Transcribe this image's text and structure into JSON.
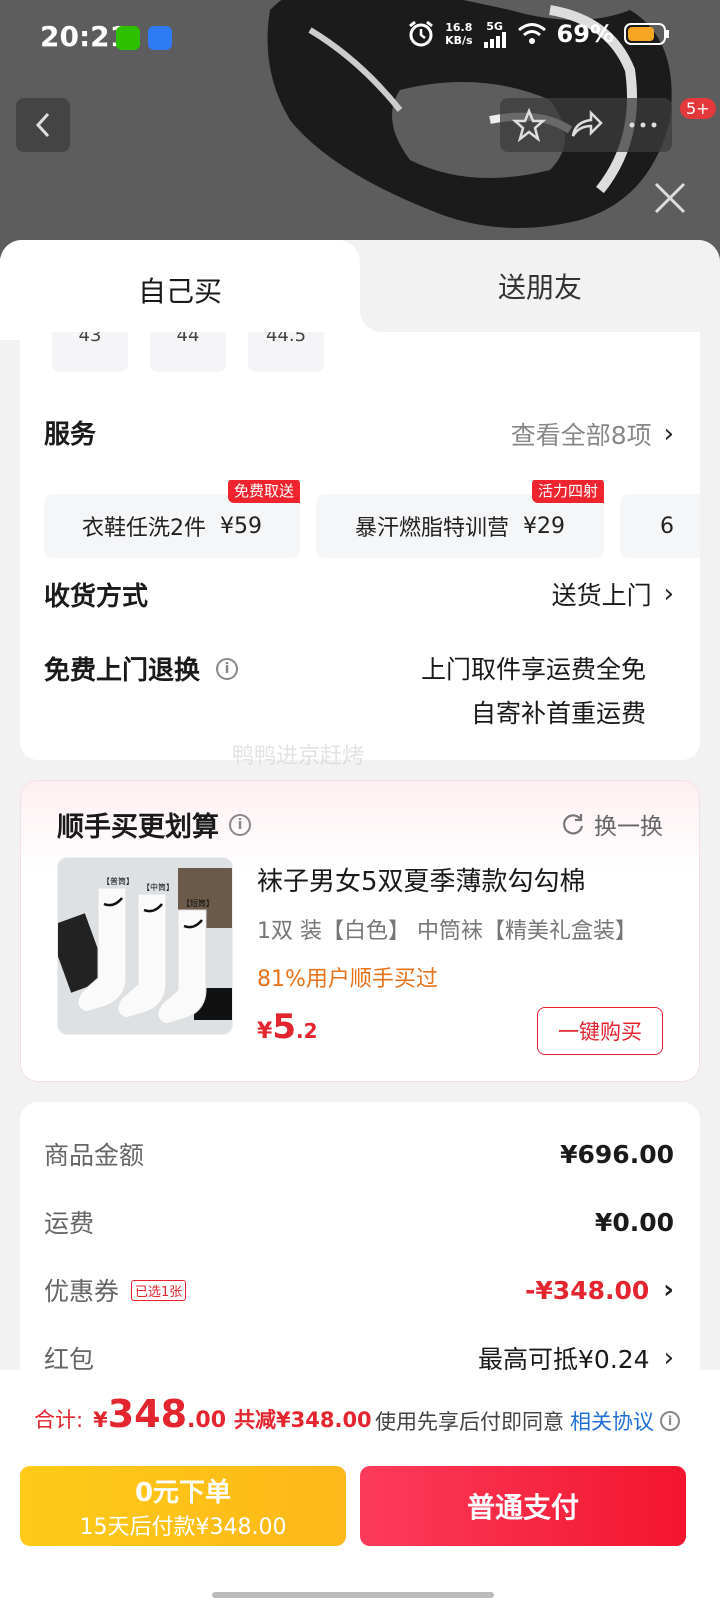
{
  "status_bar": {
    "time": "20:21",
    "net_speed_value": "16.8",
    "net_speed_unit": "KB/s",
    "network": "5G",
    "battery": "69%"
  },
  "header": {
    "cart_badge": "5+"
  },
  "tabs": {
    "self": "自己买",
    "friend": "送朋友"
  },
  "sizes": [
    "43",
    "44",
    "44.5"
  ],
  "service": {
    "title": "服务",
    "view_all": "查看全部8项",
    "items": [
      {
        "label": "衣鞋任洗2件",
        "price": "¥59",
        "tag": "免费取送"
      },
      {
        "label": "暴汗燃脂特训营",
        "price": "¥29",
        "tag": "活力四射"
      },
      {
        "label": "6",
        "price": "",
        "tag": ""
      }
    ]
  },
  "delivery": {
    "title": "收货方式",
    "value": "送货上门"
  },
  "free_return": {
    "title": "免费上门退换",
    "line1": "上门取件享运费全免",
    "line2": "自寄补首重运费"
  },
  "watermark": "鸭鸭进京赶烤",
  "addon": {
    "title": "顺手买更划算",
    "swap": "换一换",
    "product_name": "袜子男女5双夏季薄款勾勾棉",
    "spec": "1双 装【白色】 中筒袜【精美礼盒装】",
    "bought_pct": "81%用户顺手买过",
    "price_symbol": "¥",
    "price_int": "5",
    "price_dec": ".2",
    "buy_label": "一键购买",
    "image_tags": [
      "【普筒】",
      "【中筒】",
      "【短筒】"
    ]
  },
  "summary": {
    "goods_label": "商品金额",
    "goods_value": "¥696.00",
    "shipping_label": "运费",
    "shipping_value": "¥0.00",
    "coupon_label": "优惠券",
    "coupon_tag": "已选1张",
    "coupon_value": "-¥348.00",
    "redpacket_label": "红包",
    "redpacket_value": "最高可抵¥0.24"
  },
  "bottom": {
    "total_label": "合计:",
    "total_symbol": "¥",
    "total_int": "348",
    "total_dec": ".00",
    "saved": "共减¥348.00",
    "agree_text": "使用先享后付即同意",
    "agree_link": "相关协议",
    "pay_later_line1": "0元下单",
    "pay_later_line2": "15天后付款¥348.00",
    "pay_normal": "普通支付"
  },
  "colors": {
    "accent_red": "#e4242e",
    "pay_later_yellow": "#ffcb17",
    "link_blue": "#1f6fd6",
    "orange": "#e6721a"
  }
}
